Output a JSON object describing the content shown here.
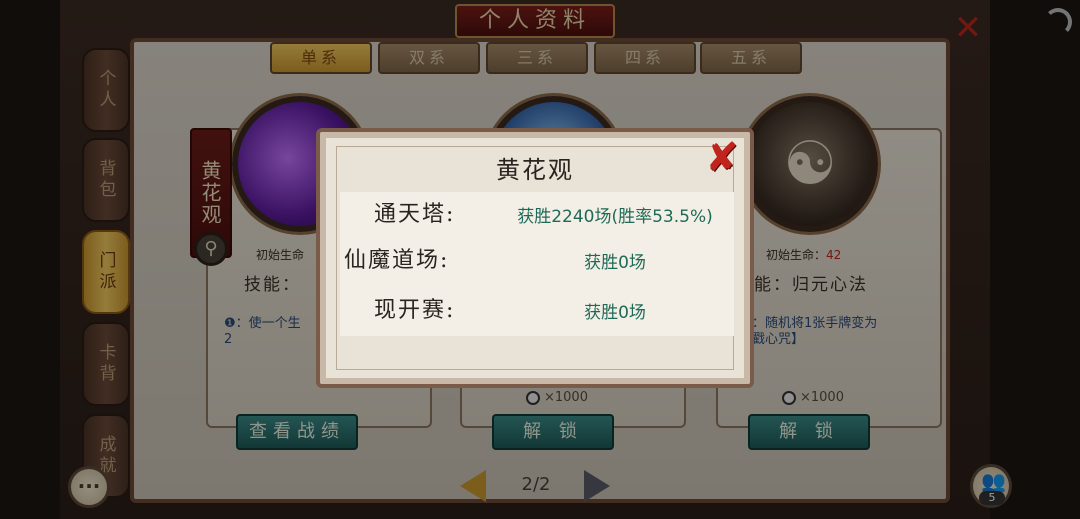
{
  "header": {
    "title": "个人资料"
  },
  "sidebar": {
    "items": [
      {
        "label": "个人",
        "active": false
      },
      {
        "label": "背包",
        "active": false
      },
      {
        "label": "门派",
        "active": true
      },
      {
        "label": "卡背",
        "active": false
      },
      {
        "label": "成就",
        "active": false
      }
    ]
  },
  "element_tabs": [
    {
      "label": "单系",
      "active": true
    },
    {
      "label": "双系",
      "active": false
    },
    {
      "label": "三系",
      "active": false
    },
    {
      "label": "四系",
      "active": false
    },
    {
      "label": "五系",
      "active": false
    }
  ],
  "cards": [
    {
      "sect_name": "黄花观",
      "hp_label": "初始生命",
      "skill_prefix": "技能：",
      "desc_num": "❶",
      "desc": "：使一个生",
      "desc_line2": "2",
      "action": "查看战绩"
    },
    {
      "cost": "×1000",
      "action": "解 锁"
    },
    {
      "hp_label": "初始生命：",
      "hp_value": "42",
      "skill": "能：归元心法",
      "desc": "：随机将1张手牌变为",
      "desc_line2": "戳心咒】",
      "cost": "×1000",
      "action": "解 锁"
    }
  ],
  "pager": {
    "current": "2/2"
  },
  "friends": {
    "count": "5"
  },
  "modal": {
    "title": "黄花观",
    "stats": [
      {
        "label": "通天塔:",
        "value": "获胜2240场(胜率53.5%)"
      },
      {
        "label": "仙魔道场:",
        "value": "获胜0场"
      },
      {
        "label": "现开赛:",
        "value": "获胜0场"
      }
    ]
  },
  "colors": {
    "accent_gold": "#c8962e",
    "win_text": "#1e6a58",
    "close_red": "#c0241c"
  }
}
